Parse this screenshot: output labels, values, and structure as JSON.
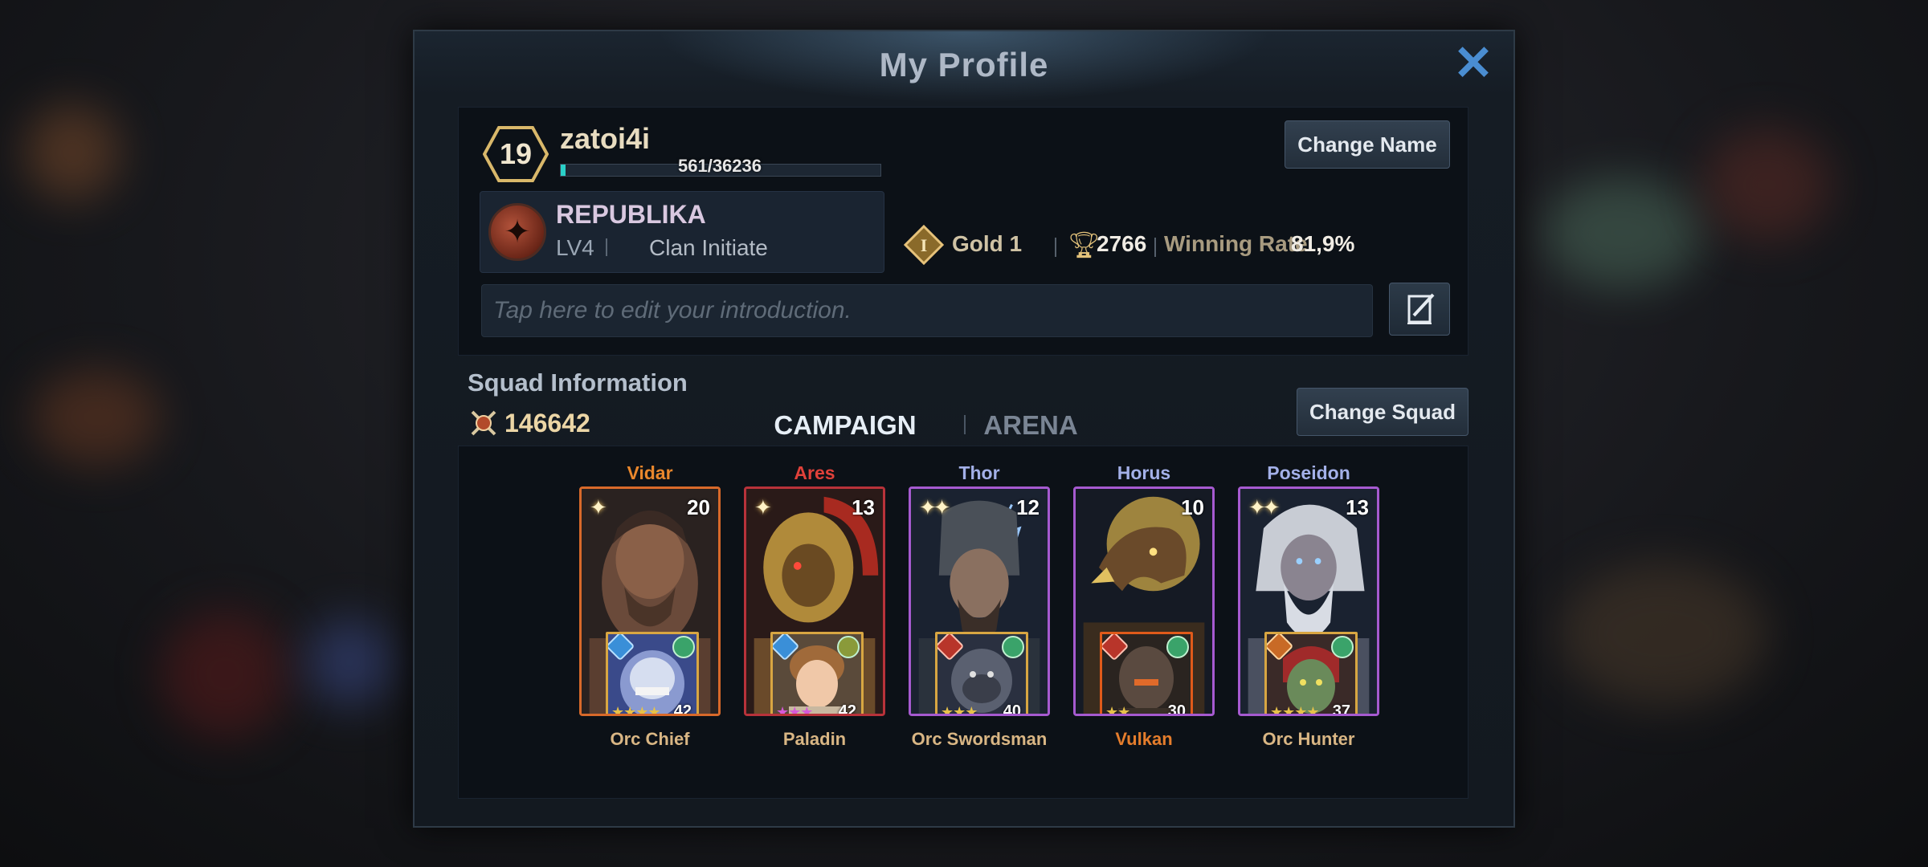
{
  "dialog": {
    "title": "My Profile",
    "close_icon": "close-icon"
  },
  "profile": {
    "level": "19",
    "name": "zatoi4i",
    "xp_text": "561/36236",
    "xp_progress": 0.0155,
    "change_name_label": "Change Name",
    "clan": {
      "name": "REPUBLIKA",
      "level": "LV4",
      "role": "Clan Initiate"
    },
    "rank": {
      "tier_icon": "I",
      "tier": "Gold 1",
      "trophies": "2766",
      "winning_rate_label": "Winning Rate",
      "winning_rate": "81,9%"
    },
    "intro_placeholder": "Tap here to edit your introduction."
  },
  "squad": {
    "title": "Squad Information",
    "power": "146642",
    "tabs": [
      {
        "label": "CAMPAIGN",
        "active": true
      },
      {
        "label": "ARENA",
        "active": false
      }
    ],
    "change_squad_label": "Change Squad",
    "heroes": [
      {
        "name": "Vidar",
        "name_color": "#e9872c",
        "stars": "✦",
        "level": "20",
        "frame_color": "#d8692a",
        "unit": {
          "name": "Orc Chief",
          "stars": "★★★★",
          "star_color": "#e6c24a",
          "level": "42",
          "class_color": "blue",
          "highlight": false
        }
      },
      {
        "name": "Ares",
        "name_color": "#e0413a",
        "stars": "✦",
        "level": "13",
        "frame_color": "#b8323a",
        "unit": {
          "name": "Paladin",
          "stars": "★★★",
          "star_color": "#d65ad8",
          "level": "42",
          "class_color": "blue",
          "highlight": false
        }
      },
      {
        "name": "Thor",
        "name_color": "#a3b0e8",
        "stars": "✦✦",
        "level": "12",
        "frame_color": "#a65ad0",
        "unit": {
          "name": "Orc Swordsman",
          "stars": "★★★",
          "star_color": "#e6c24a",
          "level": "40",
          "class_color": "red",
          "highlight": false
        }
      },
      {
        "name": "Horus",
        "name_color": "#a3b0e8",
        "stars": "",
        "level": "10",
        "frame_color": "#a65ad0",
        "unit": {
          "name": "Vulkan",
          "stars": "★★",
          "star_color": "#e6c24a",
          "level": "30",
          "class_color": "red",
          "highlight": true
        }
      },
      {
        "name": "Poseidon",
        "name_color": "#a3b0e8",
        "stars": "✦✦",
        "level": "13",
        "frame_color": "#a65ad0",
        "unit": {
          "name": "Orc Hunter",
          "stars": "★★★★",
          "star_color": "#e6c24a",
          "level": "37",
          "class_color": "orange",
          "highlight": false
        }
      }
    ]
  }
}
